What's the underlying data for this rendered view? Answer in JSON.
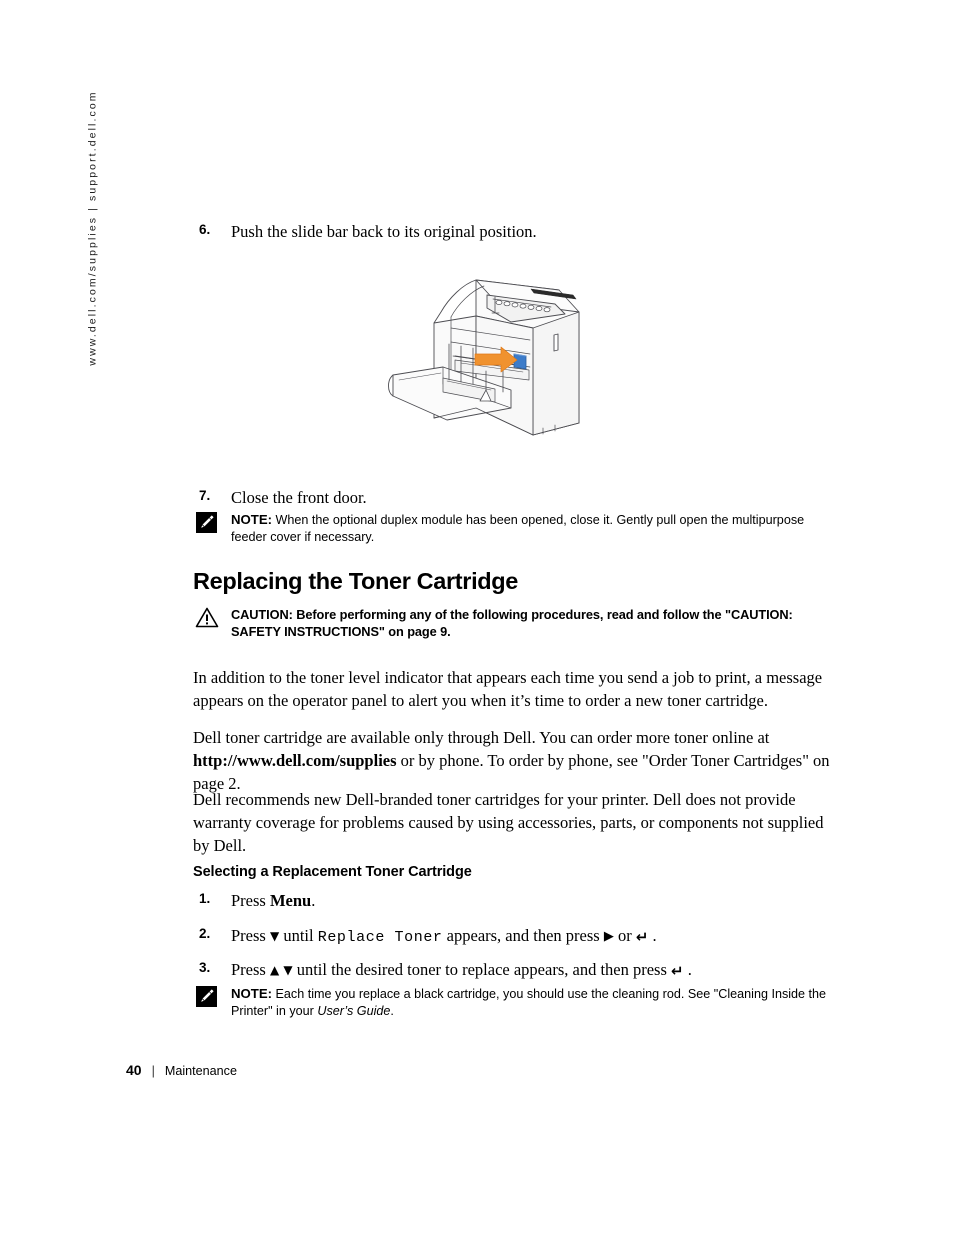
{
  "side_url": "www.dell.com/supplies | support.dell.com",
  "steps_top": [
    {
      "num": "6.",
      "text": "Push the slide bar back to its original position."
    },
    {
      "num": "7.",
      "text": "Close the front door."
    }
  ],
  "note_duplex": {
    "label": "NOTE:",
    "text": "When the optional duplex module has been opened, close it. Gently pull open the multipurpose feeder cover if necessary."
  },
  "section": {
    "title": "Replacing the Toner Cartridge"
  },
  "caution": {
    "label": "CAUTION:",
    "text": "Before performing any of the following procedures, read and follow the \"CAUTION: SAFETY INSTRUCTIONS\" on page 9."
  },
  "paragraphs": {
    "p1": "In addition to the toner level indicator that appears each time you send a job to print, a message appears on the operator panel to alert you when it’s time to order a new toner cartridge.",
    "p2_before": "Dell toner cartridge are available only through Dell. You can order more toner online at ",
    "p2_url": "http://www.dell.com/supplies",
    "p2_after": " or by phone. To order by phone, see \"Order Toner Cartridges\" on page 2.",
    "p3": "Dell recommends new Dell-branded toner cartridges for your printer. Dell does not provide warranty coverage for problems caused by using accessories, parts, or components not supplied by Dell."
  },
  "subsection": {
    "title": "Selecting a Replacement Toner Cartridge"
  },
  "procedure": {
    "step1": {
      "num": "1.",
      "pre": "Press ",
      "bold": "Menu",
      "post": "."
    },
    "step2": {
      "num": "2.",
      "pre": "Press ",
      "arrow_down": "▼",
      "mid1": " until ",
      "mono": "Replace Toner",
      "mid2": " appears, and then press ",
      "arrow_right": "▶",
      "mid3": " or ",
      "enter": "↵",
      "post": " ."
    },
    "step3": {
      "num": "3.",
      "pre": "Press ",
      "arrow_up": "▲",
      "arrow_down": "▼",
      "mid1": " until the desired toner to replace appears, and then press ",
      "enter": "↵",
      "post": " ."
    }
  },
  "note_cleaning": {
    "label": "NOTE:",
    "text_before": "Each time you replace a black cartridge, you should use the cleaning rod. See \"Cleaning Inside the Printer\" in your ",
    "italic": "User’s Guide",
    "text_after": "."
  },
  "footer": {
    "page_number": "40",
    "separator": "|",
    "chapter": "Maintenance"
  },
  "illustration": {
    "name": "laser-printer-front-door-open",
    "arrow_color": "#F0922F",
    "tab_color": "#3D7CC9",
    "body_color": "#FAFAFA",
    "line_color": "#4D4D52"
  }
}
